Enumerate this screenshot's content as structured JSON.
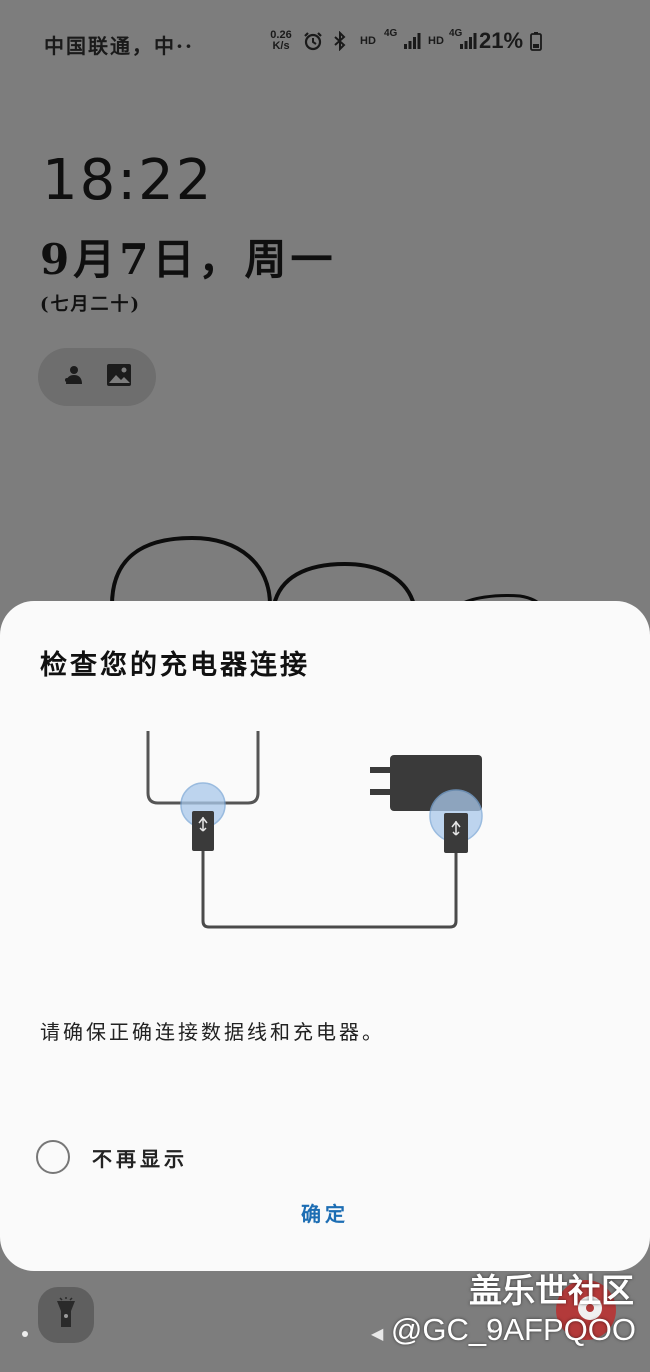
{
  "status_bar": {
    "carrier": "中国联通，中··",
    "net_speed_value": "0.26",
    "net_speed_unit": "K/s",
    "hd1": "HD",
    "hd2": "HD",
    "net1": "4G",
    "net2": "4G",
    "battery": "21%",
    "icons": [
      "alarm-icon",
      "bluetooth-icon",
      "signal-icon",
      "signal-icon",
      "battery-icon"
    ]
  },
  "lockscreen": {
    "time": "18:22",
    "date": "9月7日，周一",
    "lunar": "(七月二十)",
    "widget_icons": [
      "bixby-icon",
      "gallery-icon"
    ]
  },
  "dialog": {
    "title": "检查您的充电器连接",
    "message": "请确保正确连接数据线和充电器。",
    "checkbox_label": "不再显示",
    "checkbox_checked": false,
    "ok_label": "确定",
    "accent_color": "#1c6db3"
  },
  "bottom": {
    "icons": [
      "flashlight-icon",
      "back-icon",
      "down-arrow-icon"
    ]
  },
  "watermark": {
    "site": "盖乐世社区",
    "user": "@GC_9AFPQOO"
  }
}
